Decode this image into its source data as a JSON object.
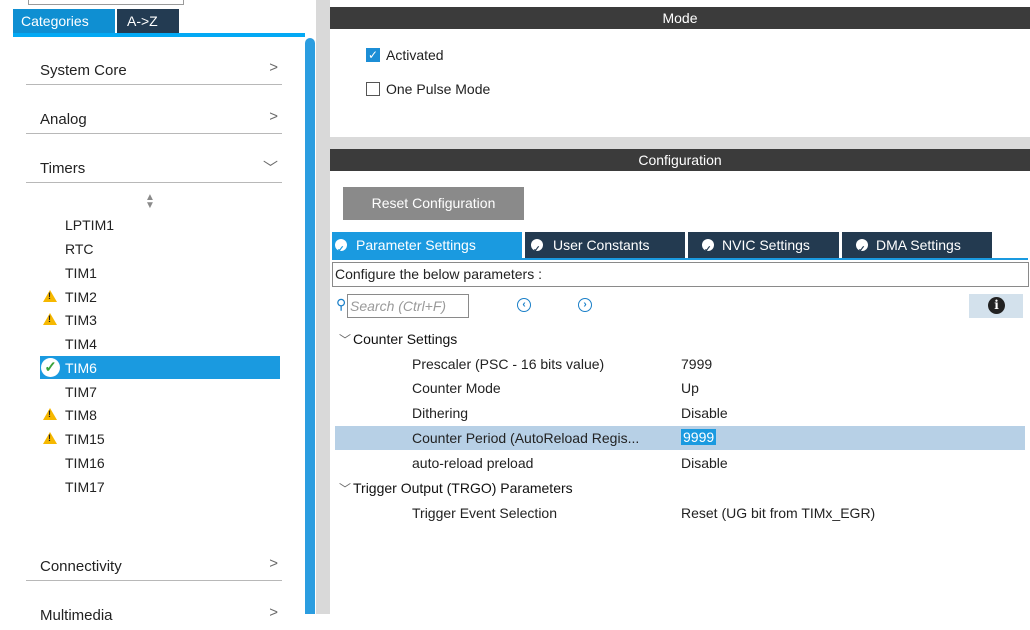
{
  "left": {
    "tabs": [
      {
        "label": "Categories"
      },
      {
        "label": "A->Z"
      }
    ],
    "categories": [
      {
        "label": "System Core",
        "chevron": "chevron-right"
      },
      {
        "label": "Analog",
        "chevron": "chevron-right"
      },
      {
        "label": "Timers",
        "chevron": "chevron-down"
      },
      {
        "label": "Connectivity",
        "chevron": "chevron-right"
      },
      {
        "label": "Multimedia",
        "chevron": "chevron-right"
      }
    ],
    "timers": [
      {
        "label": "LPTIM1",
        "status": "none"
      },
      {
        "label": "RTC",
        "status": "none"
      },
      {
        "label": "TIM1",
        "status": "none"
      },
      {
        "label": "TIM2",
        "status": "warning"
      },
      {
        "label": "TIM3",
        "status": "warning"
      },
      {
        "label": "TIM4",
        "status": "none"
      },
      {
        "label": "TIM6",
        "status": "ok"
      },
      {
        "label": "TIM7",
        "status": "none"
      },
      {
        "label": "TIM8",
        "status": "warning"
      },
      {
        "label": "TIM15",
        "status": "warning"
      },
      {
        "label": "TIM16",
        "status": "none"
      },
      {
        "label": "TIM17",
        "status": "none"
      }
    ]
  },
  "mode": {
    "title": "Mode",
    "options": [
      {
        "label": "Activated",
        "checked": true
      },
      {
        "label": "One Pulse Mode",
        "checked": false
      }
    ]
  },
  "configuration": {
    "title": "Configuration",
    "reset_label": "Reset Configuration",
    "tabs": [
      {
        "label": "Parameter Settings",
        "active": true
      },
      {
        "label": "User Constants",
        "active": false
      },
      {
        "label": "NVIC Settings",
        "active": false
      },
      {
        "label": "DMA Settings",
        "active": false
      }
    ],
    "hint": "Configure the below parameters :",
    "search_placeholder": "Search (Ctrl+F)",
    "groups": [
      {
        "label": "Counter Settings",
        "params": [
          {
            "name": "Prescaler (PSC - 16 bits value)",
            "value": "7999"
          },
          {
            "name": "Counter Mode",
            "value": "Up"
          },
          {
            "name": "Dithering",
            "value": "Disable"
          },
          {
            "name": "Counter Period (AutoReload Regis...",
            "value": "9999",
            "selected": true
          },
          {
            "name": "auto-reload preload",
            "value": "Disable"
          }
        ]
      },
      {
        "label": "Trigger Output (TRGO) Parameters",
        "params": [
          {
            "name": "Trigger Event Selection",
            "value": "Reset (UG bit from TIMx_EGR)"
          }
        ]
      }
    ]
  },
  "colors": {
    "accent": "#1a9ae0",
    "tab_dark": "#233a50",
    "header_bar": "#3b3b3b",
    "warning": "#f6b800",
    "ok": "#3aa33a"
  }
}
